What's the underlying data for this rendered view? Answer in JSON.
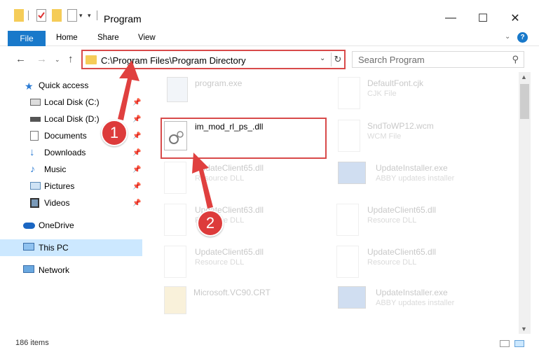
{
  "window": {
    "title": "Program"
  },
  "ribbon": {
    "tabs": [
      "File",
      "Home",
      "Share",
      "View"
    ]
  },
  "address": {
    "path": "C:\\Program Files\\Program Directory"
  },
  "search": {
    "placeholder": "Search Program"
  },
  "nav": {
    "items": [
      {
        "label": "Quick access",
        "icon": "star-icon",
        "pinned": false,
        "selected": false
      },
      {
        "label": "Local Disk (C:)",
        "icon": "drive-icon",
        "pinned": true,
        "selected": false
      },
      {
        "label": "Local Disk (D:)",
        "icon": "drive-icon",
        "pinned": true,
        "selected": false
      },
      {
        "label": "Documents",
        "icon": "documents-icon",
        "pinned": true,
        "selected": false
      },
      {
        "label": "Downloads",
        "icon": "download-icon",
        "pinned": true,
        "selected": false
      },
      {
        "label": "Music",
        "icon": "music-icon",
        "pinned": true,
        "selected": false
      },
      {
        "label": "Pictures",
        "icon": "pictures-icon",
        "pinned": true,
        "selected": false
      },
      {
        "label": "Videos",
        "icon": "videos-icon",
        "pinned": true,
        "selected": false
      },
      {
        "label": "OneDrive",
        "icon": "cloud-icon",
        "pinned": false,
        "selected": false
      },
      {
        "label": "This PC",
        "icon": "computer-icon",
        "pinned": false,
        "selected": true
      },
      {
        "label": "Network",
        "icon": "network-icon",
        "pinned": false,
        "selected": false
      }
    ]
  },
  "files": [
    {
      "name": "program.exe",
      "type": "",
      "icon": "exe-icon",
      "active": false
    },
    {
      "name": "DefaultFont.cjk",
      "type": "CJK File",
      "icon": "blank-doc-icon",
      "active": false
    },
    {
      "name": "im_mod_rl_ps_.dll",
      "type": "",
      "icon": "dll-icon",
      "active": true
    },
    {
      "name": "SndToWP12.wcm",
      "type": "WCM File",
      "icon": "blank-doc-icon",
      "active": false
    },
    {
      "name": "UpdateClient65.dll",
      "type": "Resource DLL",
      "icon": "dll-icon",
      "active": false
    },
    {
      "name": "UpdateInstaller.exe",
      "type": "ABBY updates installer",
      "icon": "installer-icon",
      "active": false
    },
    {
      "name": "UpdateClient63.dll",
      "type": "Resource DLL",
      "icon": "dll-icon",
      "active": false
    },
    {
      "name": "UpdateClient65.dll",
      "type": "Resource DLL",
      "icon": "dll-icon",
      "active": false
    },
    {
      "name": "UpdateClient65.dll",
      "type": "Resource DLL",
      "icon": "dll-icon",
      "active": false
    },
    {
      "name": "UpdateClient65.dll",
      "type": "Resource DLL",
      "icon": "dll-icon",
      "active": false
    },
    {
      "name": "Microsoft.VC90.CRT",
      "type": "",
      "icon": "folder-icon",
      "active": false
    },
    {
      "name": "UpdateInstaller.exe",
      "type": "ABBY updates installer",
      "icon": "installer-icon",
      "active": false
    }
  ],
  "status": {
    "item_count": "186 items"
  },
  "annotations": {
    "step1": "1",
    "step2": "2"
  },
  "colors": {
    "accent": "#1979ca",
    "highlight": "#d84a4a",
    "selected": "#cce8ff"
  }
}
